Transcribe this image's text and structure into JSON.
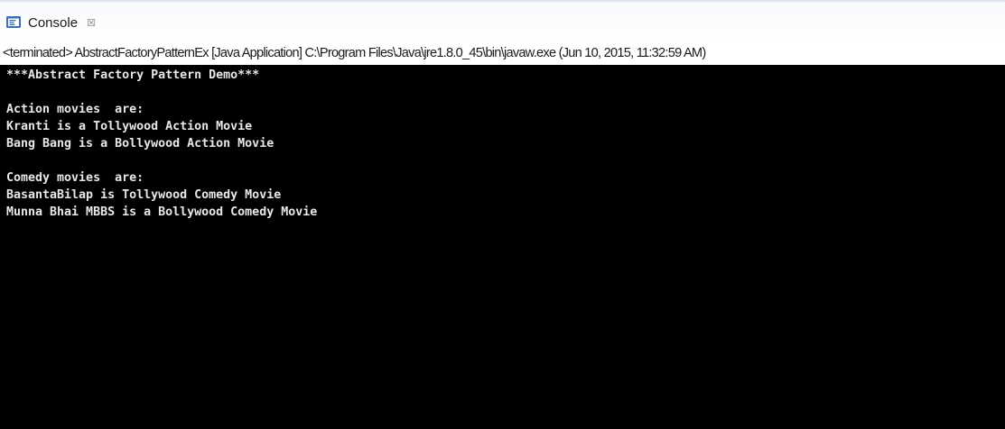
{
  "tab": {
    "label": "Console",
    "icon": "console-icon",
    "close_symbol": "☒"
  },
  "status": {
    "text": "<terminated> AbstractFactoryPatternEx [Java Application] C:\\Program Files\\Java\\jre1.8.0_45\\bin\\javaw.exe (Jun 10, 2015, 11:32:59 AM)"
  },
  "console": {
    "lines": [
      "***Abstract Factory Pattern Demo***",
      "",
      "Action movies  are:",
      "Kranti is a Tollywood Action Movie",
      "Bang Bang is a Bollywood Action Movie",
      "",
      "Comedy movies  are:",
      "BasantaBilap is Tollywood Comedy Movie",
      "Munna Bhai MBBS is a Bollywood Comedy Movie"
    ]
  },
  "colors": {
    "console_background": "#000000",
    "console_text": "#e8e8e8",
    "tab_bar_border": "#dfe6f0"
  }
}
